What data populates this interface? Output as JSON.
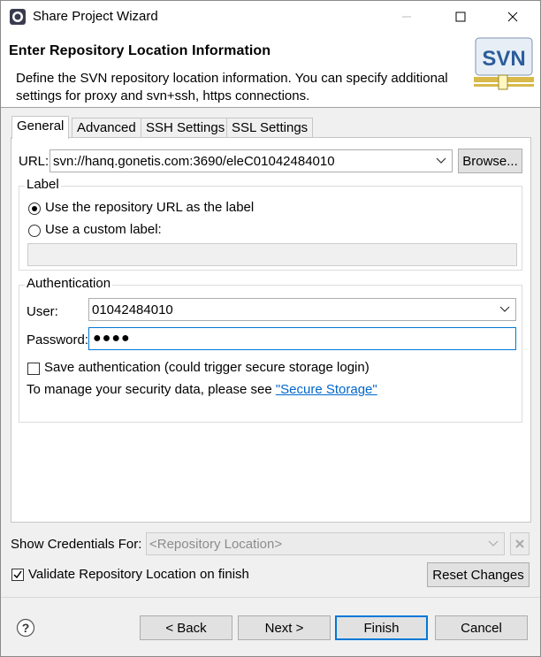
{
  "window": {
    "title": "Share Project Wizard"
  },
  "header": {
    "title": "Enter Repository Location Information",
    "description": "Define the SVN repository location information. You can specify additional settings for proxy and svn+ssh, https connections.",
    "logo_text": "SVN"
  },
  "tabs": [
    {
      "label": "General"
    },
    {
      "label": "Advanced"
    },
    {
      "label": "SSH Settings"
    },
    {
      "label": "SSL Settings"
    }
  ],
  "url": {
    "label": "URL:",
    "value": "svn://hanq.gonetis.com:3690/eleC01042484010",
    "browse_label": "Browse..."
  },
  "label_group": {
    "title": "Label",
    "option_repo": "Use the repository URL as the label",
    "option_custom": "Use a custom label:",
    "custom_value": "",
    "selected": "repo"
  },
  "auth": {
    "title": "Authentication",
    "user_label": "User:",
    "user_value": "01042484010",
    "password_label": "Password:",
    "password_value": "●●●●",
    "save_label": "Save authentication (could trigger secure storage login)",
    "save_checked": false,
    "manage_text": "To manage your security data, please see",
    "manage_link": "\"Secure Storage\""
  },
  "credentials": {
    "label": "Show Credentials For:",
    "value": "<Repository Location>"
  },
  "validate": {
    "label": "Validate Repository Location on finish",
    "checked": true
  },
  "reset_label": "Reset Changes",
  "buttons": {
    "back": "< Back",
    "next": "Next >",
    "finish": "Finish",
    "cancel": "Cancel"
  },
  "colors": {
    "link": "#0066cc",
    "default_button_border": "#0078d7",
    "svn_logo": "#2b5d9b"
  }
}
